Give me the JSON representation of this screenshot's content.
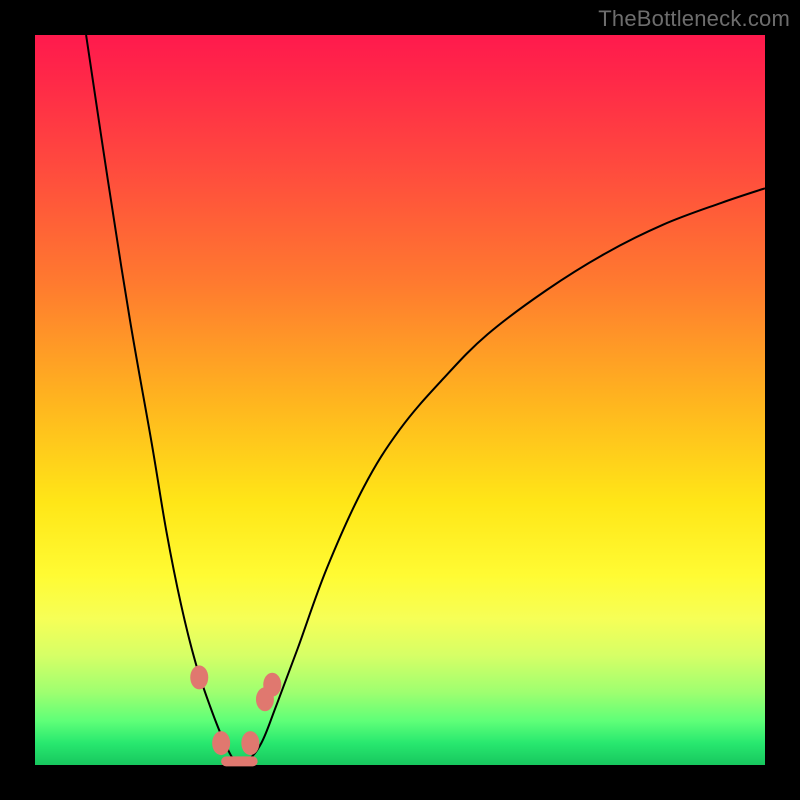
{
  "watermark": "TheBottleneck.com",
  "colors": {
    "frame": "#000000",
    "curve": "#000000",
    "marker": "#e0786f",
    "gradient_stops": [
      "#ff1a4d",
      "#ff2848",
      "#ff4a3e",
      "#ff7a2f",
      "#ffb41f",
      "#ffe617",
      "#fffb33",
      "#f6ff57",
      "#d6ff66",
      "#9fff70",
      "#5eff78",
      "#28e86f",
      "#17c75e"
    ]
  },
  "chart_data": {
    "type": "line",
    "title": "",
    "xlabel": "",
    "ylabel": "",
    "xlim": [
      0,
      100
    ],
    "ylim": [
      0,
      100
    ],
    "grid": false,
    "legend": false,
    "series": [
      {
        "name": "bottleneck-curve",
        "x": [
          7,
          10,
          13,
          16,
          18,
          20,
          22,
          24,
          26,
          27.5,
          29,
          31,
          33,
          36,
          40,
          45,
          50,
          56,
          62,
          70,
          78,
          86,
          94,
          100
        ],
        "y": [
          100,
          80,
          61,
          44,
          32,
          22,
          14,
          8,
          3,
          0.5,
          0.5,
          3,
          8,
          16,
          27,
          38,
          46,
          53,
          59,
          65,
          70,
          74,
          77,
          79
        ]
      }
    ],
    "markers": [
      {
        "x": 22.5,
        "y": 12
      },
      {
        "x": 25.5,
        "y": 3
      },
      {
        "x": 29.5,
        "y": 3
      },
      {
        "x": 31.5,
        "y": 9
      },
      {
        "x": 32.5,
        "y": 11
      }
    ],
    "flat_bottom": {
      "x_start": 25.5,
      "x_end": 30.5,
      "y": 0.5
    }
  }
}
